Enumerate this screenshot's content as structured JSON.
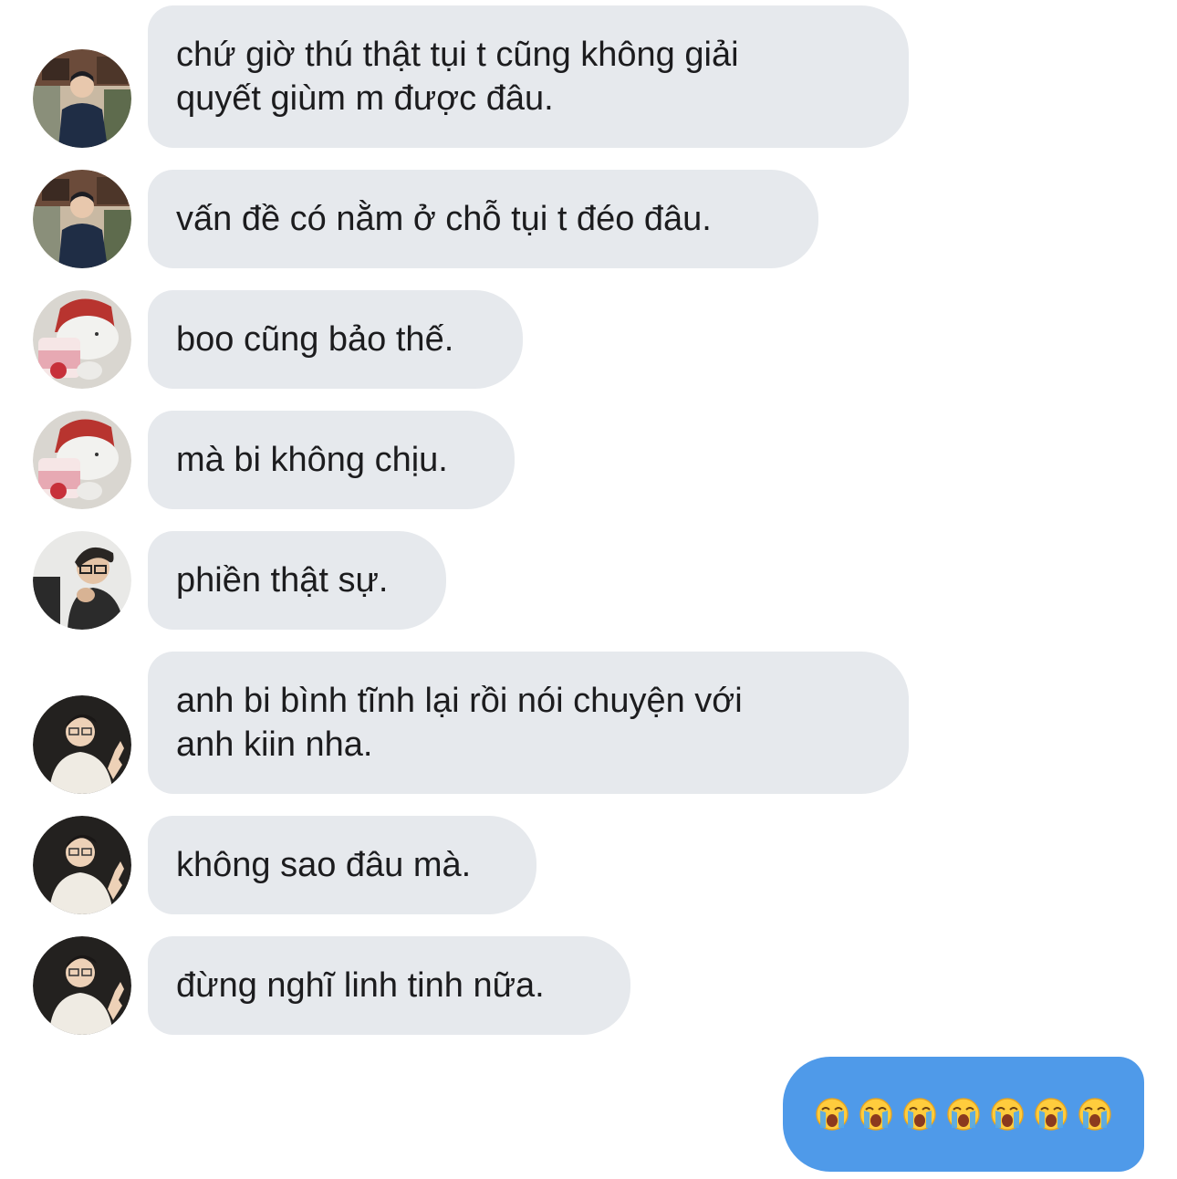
{
  "messages": [
    {
      "sender": "avatar-a",
      "text": "chứ giờ thú thật tụi t cũng không giải\nquyết giùm m được đâu."
    },
    {
      "sender": "avatar-a",
      "text": "vấn đề có nằm ở chỗ tụi t đéo đâu."
    },
    {
      "sender": "avatar-b",
      "text": "boo cũng bảo thế."
    },
    {
      "sender": "avatar-b",
      "text": "mà bi không chịu."
    },
    {
      "sender": "avatar-c",
      "text": "phiền thật sự."
    },
    {
      "sender": "avatar-d",
      "text": "anh bi bình tĩnh lại rồi nói chuyện với\nanh kiin nha."
    },
    {
      "sender": "avatar-d",
      "text": "không sao đâu mà."
    },
    {
      "sender": "avatar-d",
      "text": "đừng nghĩ linh tinh nữa."
    }
  ],
  "sent_message": {
    "emoji": [
      "😭",
      "😭",
      "😭",
      "😭",
      "😭",
      "😭",
      "😭"
    ],
    "emoji_icon": "loudly-crying-face-icon"
  },
  "colors": {
    "received_bubble": "#e6e9ed",
    "sent_bubble": "#4f9ae9",
    "text": "#1c1c1e"
  }
}
